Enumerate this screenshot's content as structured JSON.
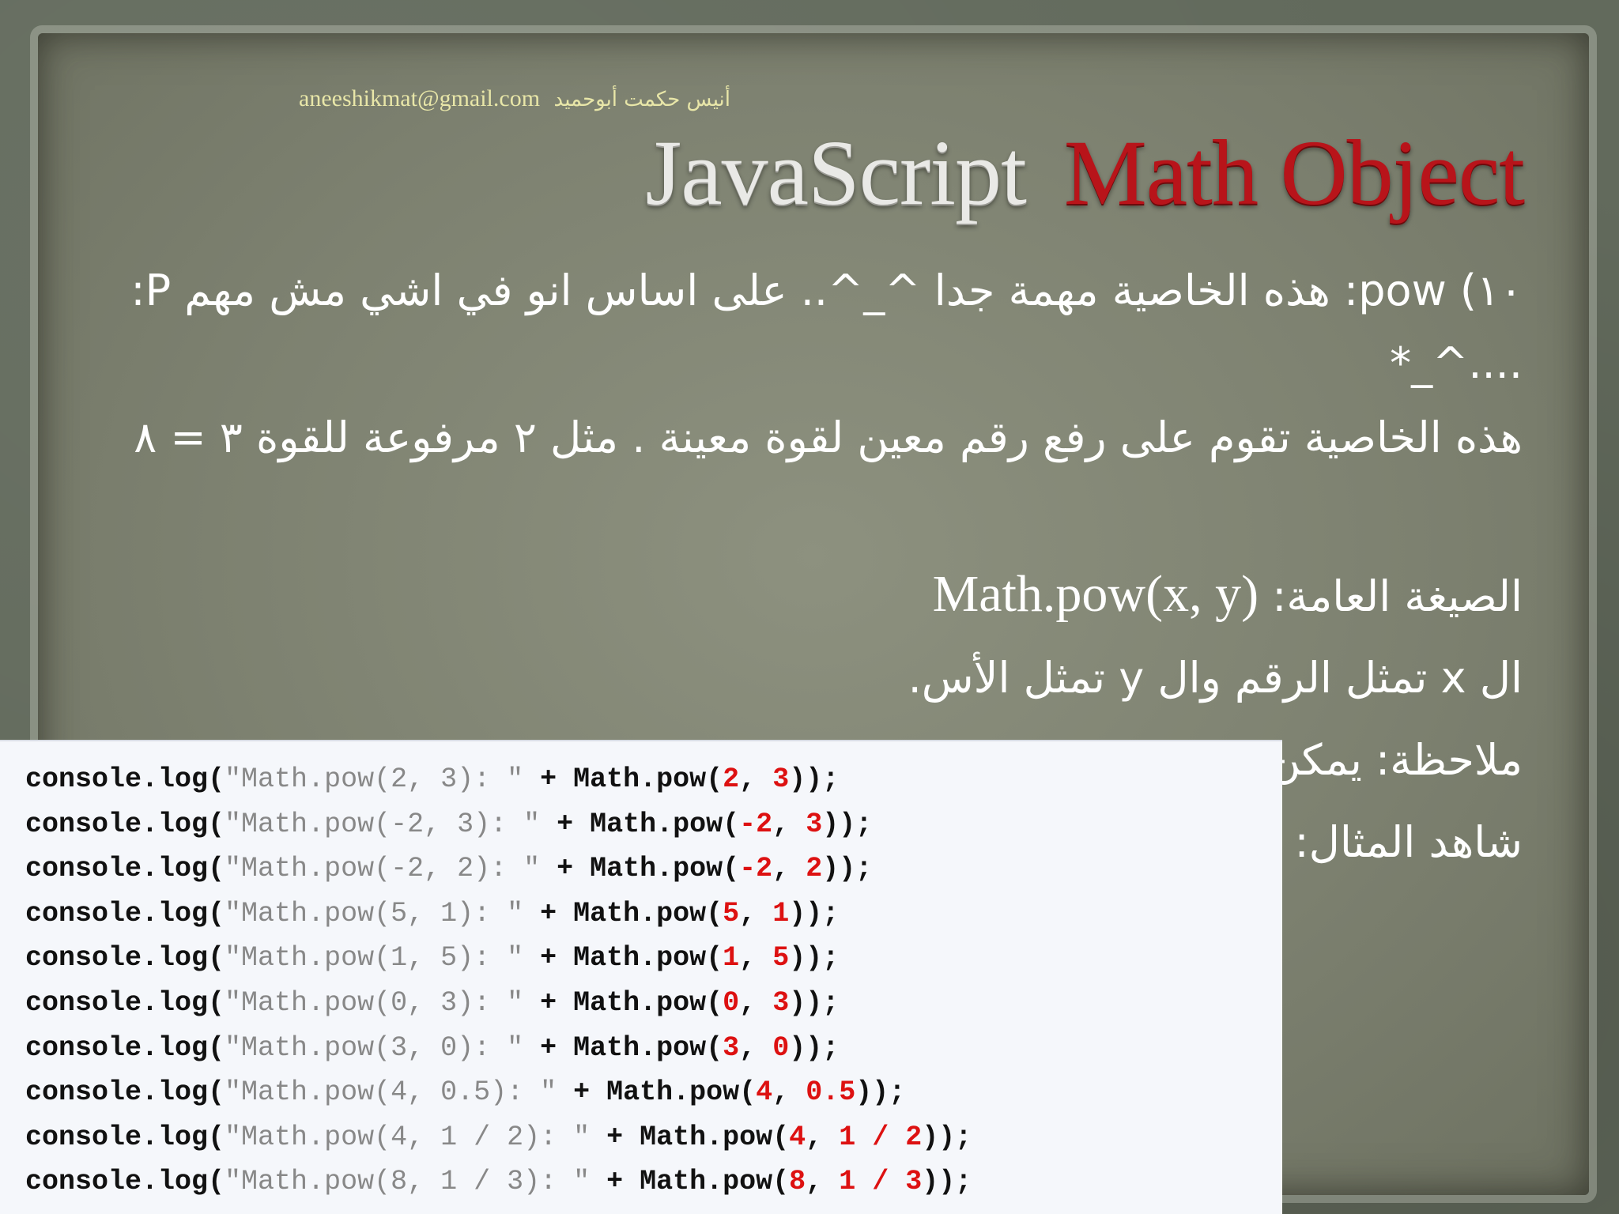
{
  "header": {
    "email": "aneeshikmat@gmail.com",
    "author": "أنيس حكمت أبوحميد"
  },
  "title": {
    "part1": "JavaScript",
    "part2": "Math Object"
  },
  "content": {
    "line1": "١٠) pow: هذه الخاصية مهمة جدا ^_^.. على اساس انو في اشي مش مهم P: ....^_*",
    "line2": "هذه الخاصية تقوم على رفع رقم معين لقوة معينة . مثل ٢ مرفوعة للقوة ٣ = ٨",
    "line3_label": "الصيغة العامة: ",
    "line3_formula": "Math.pow(x, y)",
    "line4": "ال x تمثل الرقم وال y تمثل الأس.",
    "line5": "ملاحظة: يمكن",
    "line6": "شاهد المثال:"
  },
  "code": [
    {
      "str": "\"Math.pow(2, 3): \"",
      "a": "2",
      "b": "3"
    },
    {
      "str": "\"Math.pow(-2, 3): \"",
      "a": "-2",
      "b": "3"
    },
    {
      "str": "\"Math.pow(-2, 2): \"",
      "a": "-2",
      "b": "2"
    },
    {
      "str": "\"Math.pow(5, 1): \"",
      "a": "5",
      "b": "1"
    },
    {
      "str": "\"Math.pow(1, 5): \"",
      "a": "1",
      "b": "5"
    },
    {
      "str": "\"Math.pow(0, 3): \"",
      "a": "0",
      "b": "3"
    },
    {
      "str": "\"Math.pow(3, 0): \"",
      "a": "3",
      "b": "0"
    },
    {
      "str": "\"Math.pow(4, 0.5): \"",
      "a": "4",
      "b": "0.5"
    },
    {
      "str": "\"Math.pow(4, 1 / 2): \"",
      "a": "4",
      "b": "1 / 2"
    },
    {
      "str": "\"Math.pow(8, 1 / 3): \"",
      "a": "8",
      "b": "1 / 3"
    }
  ],
  "code_tokens": {
    "prefix": "console.log(",
    "mid": " + Math.pow(",
    "sep": ", ",
    "suffix": "));"
  }
}
